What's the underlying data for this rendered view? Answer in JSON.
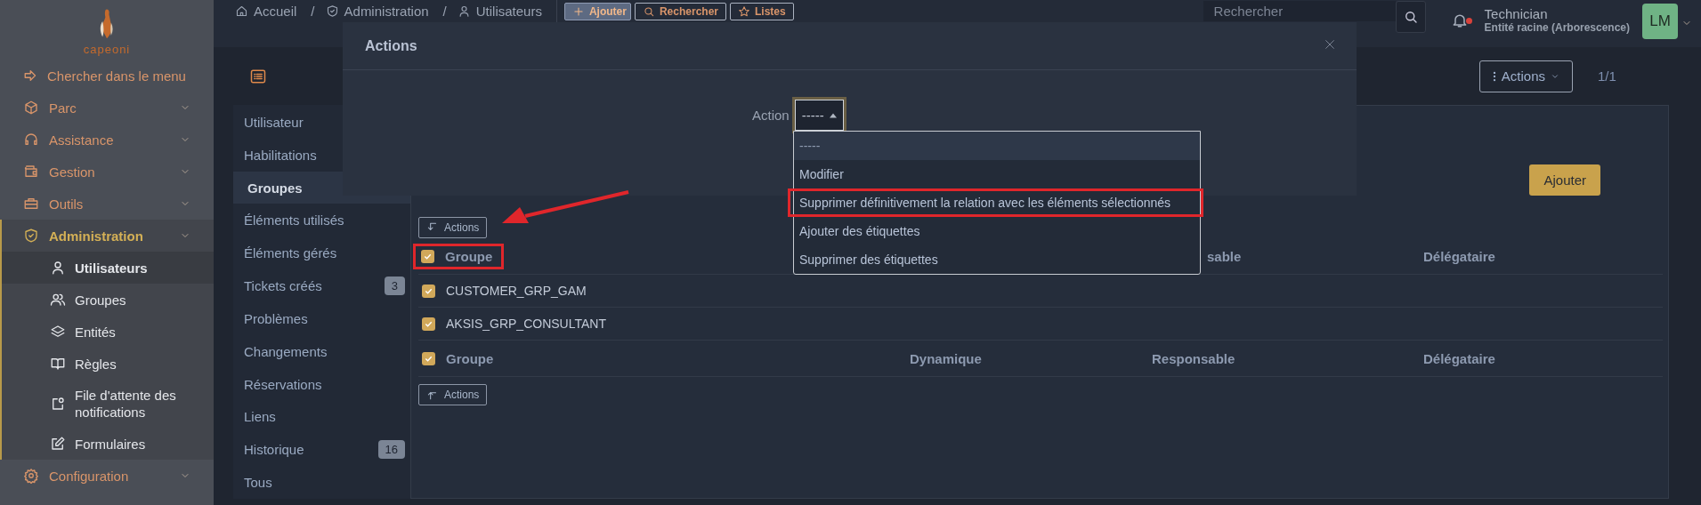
{
  "sidebar": {
    "logo": "capeoni",
    "items": [
      {
        "label": "Chercher dans le menu",
        "kind": "search"
      },
      {
        "label": "Parc",
        "kind": "section",
        "active": false
      },
      {
        "label": "Assistance",
        "kind": "section",
        "active": false
      },
      {
        "label": "Gestion",
        "kind": "section",
        "active": false
      },
      {
        "label": "Outils",
        "kind": "section",
        "active": false
      },
      {
        "label": "Administration",
        "kind": "section",
        "active": true,
        "children": [
          {
            "label": "Utilisateurs",
            "selected": true
          },
          {
            "label": "Groupes",
            "selected": false
          },
          {
            "label": "Entités",
            "selected": false
          },
          {
            "label": "Règles",
            "selected": false
          },
          {
            "label": "File d'attente des notifications",
            "selected": false
          },
          {
            "label": "Formulaires",
            "selected": false
          }
        ]
      },
      {
        "label": "Configuration",
        "kind": "section",
        "active": false
      }
    ]
  },
  "header": {
    "breadcrumb": [
      {
        "kind": "link",
        "label": "Accueil"
      },
      {
        "kind": "separator",
        "label": "/"
      },
      {
        "kind": "link",
        "label": "Administration"
      },
      {
        "kind": "separator",
        "label": "/"
      },
      {
        "kind": "link",
        "label": "Utilisateurs"
      }
    ],
    "buttons": [
      {
        "label": "Ajouter",
        "kind": "primary"
      },
      {
        "label": "Rechercher",
        "kind": "outline"
      },
      {
        "label": "Listes",
        "kind": "outline"
      }
    ],
    "search": {
      "placeholder": "Rechercher"
    },
    "notifications": {
      "unread": true
    },
    "user": {
      "name": "Technician",
      "entity": "Entité racine (Arborescence)",
      "initials": "LM"
    }
  },
  "toolbar": {
    "actions": "Actions",
    "pager": "1/1"
  },
  "tabs": [
    {
      "label": "Utilisateur",
      "selected": false
    },
    {
      "label": "Habilitations",
      "selected": false
    },
    {
      "label": "Groupes",
      "selected": true
    },
    {
      "label": "Éléments utilisés",
      "selected": false
    },
    {
      "label": "Éléments gérés",
      "selected": false
    },
    {
      "label": "Tickets créés",
      "selected": false,
      "count": "3"
    },
    {
      "label": "Problèmes",
      "selected": false
    },
    {
      "label": "Changements",
      "selected": false
    },
    {
      "label": "Réservations",
      "selected": false
    },
    {
      "label": "Liens",
      "selected": false
    },
    {
      "label": "Historique",
      "selected": false,
      "count": "16"
    },
    {
      "label": "Tous",
      "selected": false
    }
  ],
  "panel": {
    "add_button": "Ajouter",
    "top_actions": "Actions",
    "bottom_actions": "Actions",
    "header_top": {
      "checked": true,
      "highlighted": true,
      "column_1": "Groupe",
      "column_3": "sable",
      "column_4": "Délégataire"
    },
    "rows": [
      {
        "name": "CUSTOMER_GRP_GAM",
        "checked": true
      },
      {
        "name": "AKSIS_GRP_CONSULTANT",
        "checked": true
      }
    ],
    "header_bottom": {
      "checked": true,
      "columns": [
        "Groupe",
        "Dynamique",
        "Responsable",
        "Délégataire"
      ]
    }
  },
  "modal": {
    "title": "Actions",
    "field_label": "Action",
    "select_value": "-----",
    "options": [
      {
        "label": "-----",
        "selected": true,
        "highlighted": false
      },
      {
        "label": "Modifier",
        "selected": false,
        "highlighted": false
      },
      {
        "label": "Supprimer définitivement la relation avec les éléments sélectionnés",
        "selected": false,
        "highlighted": true
      },
      {
        "label": "Ajouter des étiquettes",
        "selected": false,
        "highlighted": false
      },
      {
        "label": "Supprimer des étiquettes",
        "selected": false,
        "highlighted": false
      }
    ]
  }
}
